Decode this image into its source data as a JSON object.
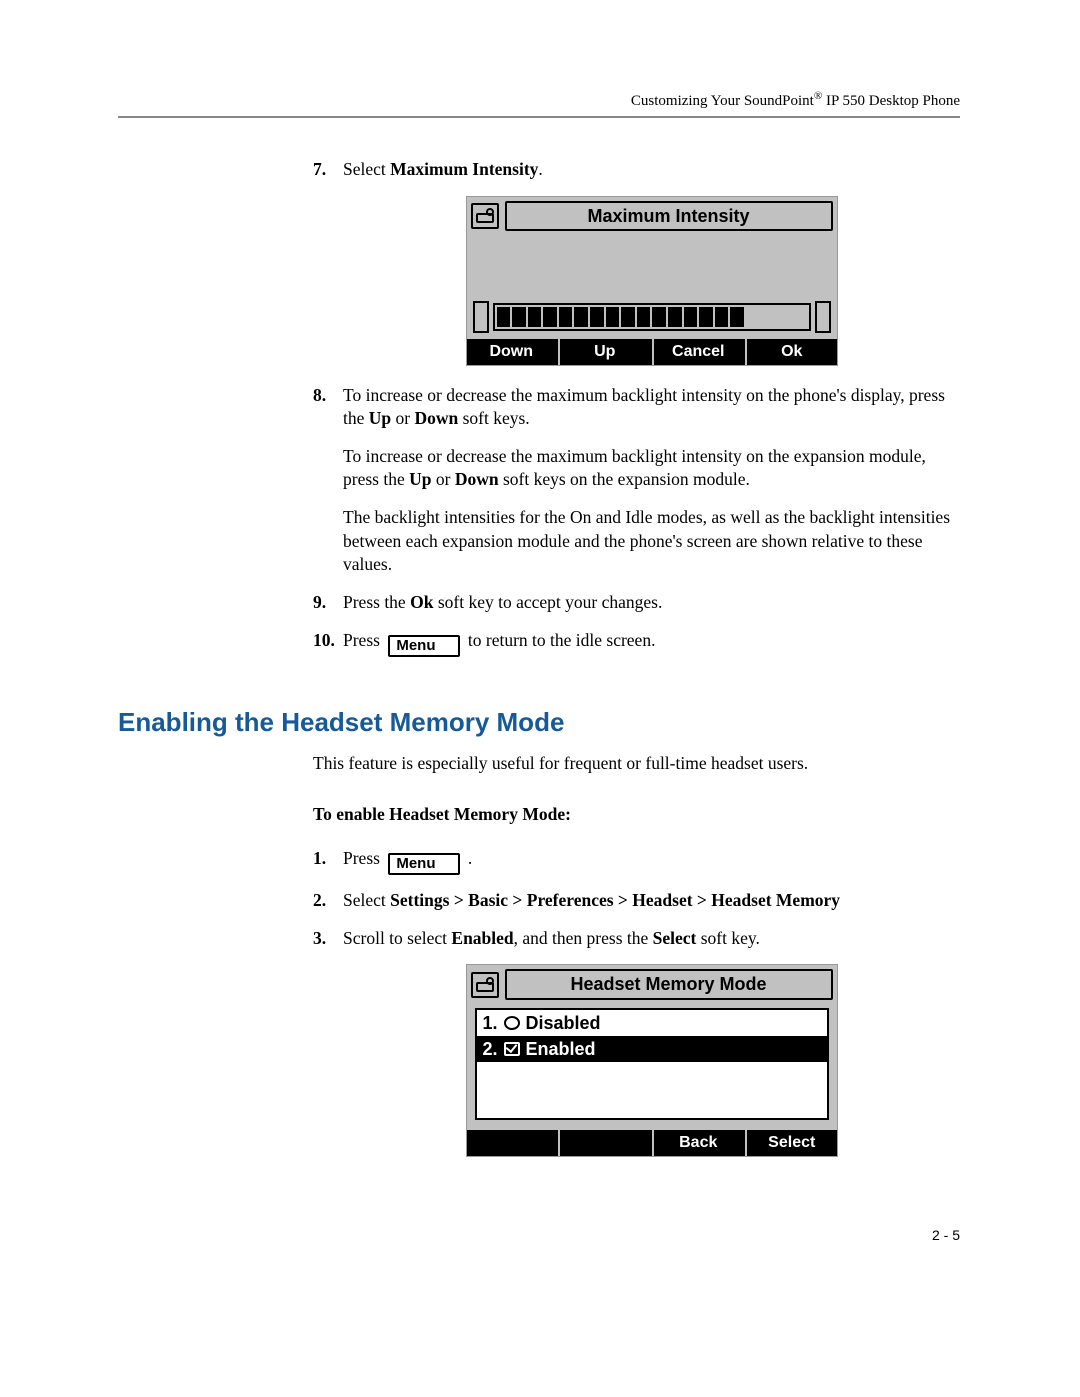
{
  "header": {
    "prefix": "Customizing Your SoundPoint",
    "reg": "®",
    "suffix": " IP 550 Desktop Phone"
  },
  "steps_a": {
    "s7": {
      "num": "7.",
      "lead": "Select ",
      "bold": "Maximum Intensity",
      "tail": "."
    },
    "s8": {
      "num": "8.",
      "p1a": "To increase or decrease the maximum backlight intensity on the phone's display, press the ",
      "p1b": "Up",
      "p1c": " or ",
      "p1d": "Down",
      "p1e": " soft keys.",
      "p2a": "To increase or decrease the maximum backlight intensity on the expansion module, press the ",
      "p2b": "Up",
      "p2c": " or ",
      "p2d": "Down",
      "p2e": " soft keys on the expansion module.",
      "p3": "The backlight intensities for the On and Idle modes, as well as the backlight intensities between each expansion module and the phone's screen are shown relative to these values."
    },
    "s9": {
      "num": "9.",
      "a": "Press the ",
      "b": "Ok",
      "c": " soft key to accept your changes."
    },
    "s10": {
      "num": "10.",
      "a": "Press ",
      "menu": "Menu",
      "b": " to return to the idle screen."
    }
  },
  "section": {
    "title": "Enabling the Headset Memory Mode",
    "intro": "This feature is especially useful for frequent or full-time headset users.",
    "subhead": "To enable Headset Memory Mode:"
  },
  "steps_b": {
    "s1": {
      "num": "1.",
      "a": "Press ",
      "menu": "Menu",
      "b": " ."
    },
    "s2": {
      "num": "2.",
      "a": "Select ",
      "b": "Settings > Basic > Preferences > Headset > Headset Memory"
    },
    "s3": {
      "num": "3.",
      "a": "Scroll to select ",
      "b": "Enabled",
      "c": ", and then press the ",
      "d": "Select",
      "e": " soft key."
    }
  },
  "lcd1": {
    "title": "Maximum Intensity",
    "softkeys": [
      "Down",
      "Up",
      "Cancel",
      "Ok"
    ],
    "segments_total": 20,
    "segments_filled": 16
  },
  "lcd2": {
    "title": "Headset Memory Mode",
    "items": [
      {
        "num": "1.",
        "label": "Disabled",
        "selected": false,
        "checked": false
      },
      {
        "num": "2.",
        "label": "Enabled",
        "selected": true,
        "checked": true
      }
    ],
    "softkeys": [
      "",
      "",
      "Back",
      "Select"
    ]
  },
  "pagenum": "2 - 5"
}
